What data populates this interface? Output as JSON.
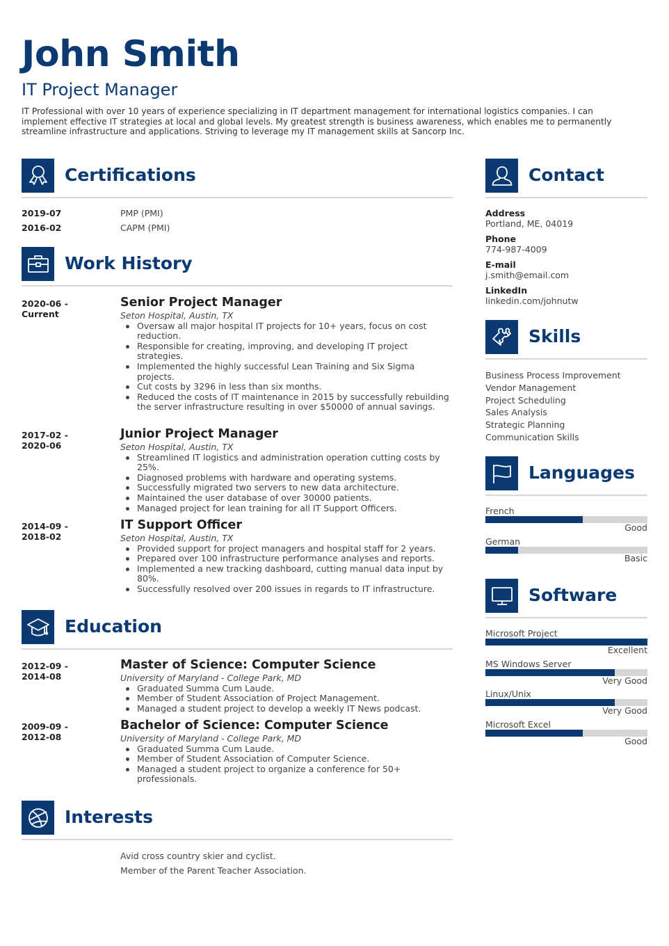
{
  "header": {
    "name": "John Smith",
    "title": "IT Project Manager",
    "summary": "IT Professional with over 10 years of experience specializing in IT department management for international logistics companies. I can implement effective IT strategies at local and global levels. My greatest strength is business awareness, which enables me to permanently streamline infrastructure and applications. Striving to leverage my IT management skills at Sancorp Inc."
  },
  "theme": {
    "accent": "#0b3a73",
    "rule": "#d6d6d6",
    "bar_track": "#d6d6d6"
  },
  "certifications": {
    "heading": "Certifications",
    "icon": "award-ribbon-icon",
    "items": [
      {
        "date": "2019-07",
        "name": "PMP (PMI)"
      },
      {
        "date": "2016-02",
        "name": "CAPM (PMI)"
      }
    ]
  },
  "work_history": {
    "heading": "Work History",
    "icon": "briefcase-icon",
    "items": [
      {
        "date": "2020-06 - Current",
        "title": "Senior Project Manager",
        "org": "Seton Hospital, Austin, TX",
        "bullets": [
          "Oversaw all major hospital IT projects for 10+ years, focus on cost reduction.",
          "Responsible for creating, improving, and developing IT project strategies.",
          "Implemented the highly successful Lean Training and Six Sigma projects.",
          "Cut costs by 3296 in less than six months.",
          "Reduced the costs of IT maintenance in 2015 by successfully rebuilding the server infrastructure resulting in over $50000 of annual savings."
        ]
      },
      {
        "date": "2017-02 - 2020-06",
        "title": "Junior Project Manager",
        "org": "Seton Hospital, Austin, TX",
        "bullets": [
          "Streamlined IT logistics and administration operation cutting costs by 25%.",
          "Diagnosed problems with hardware and operating systems.",
          "Successfully migrated two servers to new data architecture.",
          "Maintained the user database of over 30000 patients.",
          "Managed project for lean training for all IT Support Officers."
        ]
      },
      {
        "date": "2014-09 - 2018-02",
        "title": "IT Support Officer",
        "org": "Seton Hospital, Austin, TX",
        "bullets": [
          "Provided support for project managers and hospital staff for 2 years.",
          "Prepared over 100 infrastructure performance analyses and reports.",
          "Implemented a new tracking dashboard, cutting manual data input by 80%.",
          "Successfully resolved over 200 issues in regards to IT infrastructure."
        ]
      }
    ]
  },
  "education": {
    "heading": "Education",
    "icon": "graduation-cap-icon",
    "items": [
      {
        "date": "2012-09 - 2014-08",
        "title": "Master of Science: Computer Science",
        "org": "University of Maryland - College Park, MD",
        "bullets": [
          "Graduated Summa Cum Laude.",
          "Member of Student Association of Project Management.",
          "Managed a student project to develop a weekly IT News podcast."
        ]
      },
      {
        "date": "2009-09 - 2012-08",
        "title": "Bachelor of Science: Computer Science",
        "org": "University of Maryland - College Park, MD",
        "bullets": [
          "Graduated Summa Cum Laude.",
          "Member of Student Association of Computer Science.",
          "Managed a student project to organize a conference for 50+ professionals."
        ]
      }
    ]
  },
  "interests": {
    "heading": "Interests",
    "icon": "basketball-icon",
    "items": [
      "Avid cross country skier and cyclist.",
      "Member of the Parent Teacher Association."
    ]
  },
  "contact": {
    "heading": "Contact",
    "icon": "person-icon",
    "items": [
      {
        "label": "Address",
        "value": "Portland, ME, 04019"
      },
      {
        "label": "Phone",
        "value": "774-987-4009"
      },
      {
        "label": "E-mail",
        "value": "j.smith@email.com"
      },
      {
        "label": "LinkedIn",
        "value": "linkedin.com/johnutw"
      }
    ]
  },
  "skills": {
    "heading": "Skills",
    "icon": "puzzle-piece-icon",
    "items": [
      "Business Process Improvement",
      "Vendor Management",
      "Project Scheduling",
      "Sales Analysis",
      "Strategic Planning",
      "Communication Skills"
    ]
  },
  "languages": {
    "heading": "Languages",
    "icon": "flag-icon",
    "items": [
      {
        "name": "French",
        "level": "Good",
        "fraction": 0.6
      },
      {
        "name": "German",
        "level": "Basic",
        "fraction": 0.2
      }
    ]
  },
  "software": {
    "heading": "Software",
    "icon": "monitor-icon",
    "items": [
      {
        "name": "Microsoft Project",
        "level": "Excellent",
        "fraction": 1.0
      },
      {
        "name": "MS Windows Server",
        "level": "Very Good",
        "fraction": 0.8
      },
      {
        "name": "Linux/Unix",
        "level": "Very Good",
        "fraction": 0.8
      },
      {
        "name": "Microsoft Excel",
        "level": "Good",
        "fraction": 0.6
      }
    ]
  }
}
